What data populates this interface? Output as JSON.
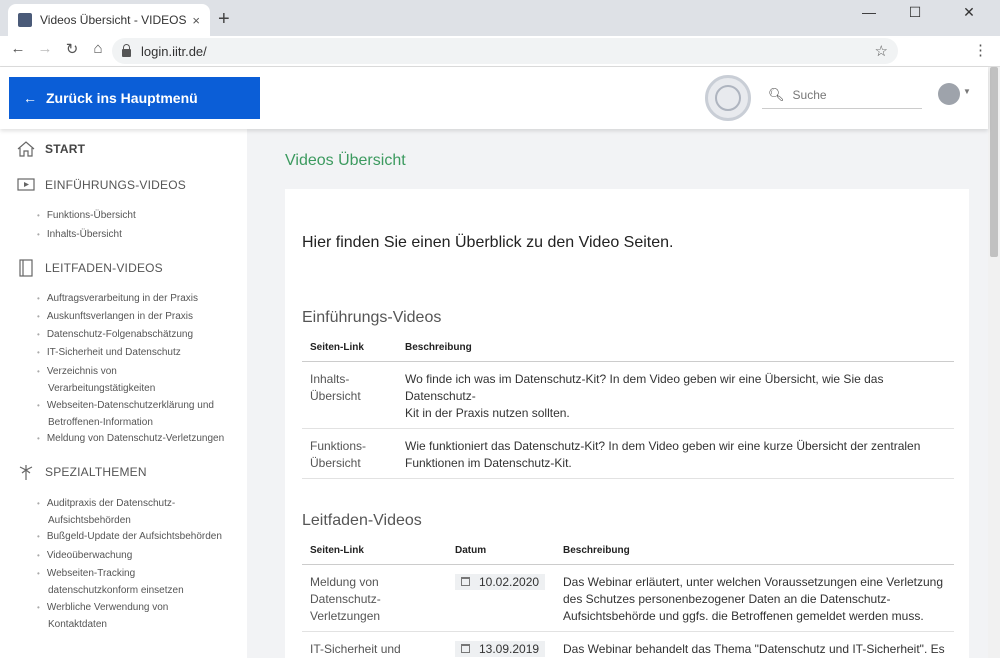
{
  "browser": {
    "tab_title": "Videos Übersicht - VIDEOS - IITR",
    "tab_close": "×",
    "new_tab": "+",
    "url": "login.iitr.de/",
    "minimize": "—",
    "maximize": "☐",
    "close": "✕"
  },
  "header": {
    "back_label": "Zurück ins Hauptmenü",
    "search_placeholder": "Suche"
  },
  "sidebar": {
    "sections": [
      {
        "label": "START",
        "icon": "home-icon",
        "items": []
      },
      {
        "label": "EINFÜHRUNGS-VIDEOS",
        "icon": "video-presentation-icon",
        "items": [
          "Funktions-Übersicht",
          "Inhalts-Übersicht"
        ]
      },
      {
        "label": "LEITFADEN-VIDEOS",
        "icon": "notebook-icon",
        "items": [
          [
            "Auftragsverarbeitung in der Praxis"
          ],
          [
            "Auskunftsverlangen in der Praxis"
          ],
          [
            "Datenschutz-Folgenabschätzung"
          ],
          [
            "IT-Sicherheit und Datenschutz"
          ],
          [
            "Verzeichnis von",
            "Verarbeitungstätigkeiten"
          ],
          [
            "Webseiten-Datenschutzerklärung und",
            "Betroffenen-Information"
          ],
          [
            "Meldung von Datenschutz-Verletzungen"
          ]
        ]
      },
      {
        "label": "SPEZIALTHEMEN",
        "icon": "palm-tree-icon",
        "items": [
          [
            "Auditpraxis der Datenschutz-",
            "Aufsichtsbehörden"
          ],
          [
            "Bußgeld-Update der Aufsichtsbehörden"
          ],
          [
            "Videoüberwachung"
          ],
          [
            "Webseiten-Tracking",
            "datenschutzkonform einsetzen"
          ],
          [
            "Werbliche Verwendung von",
            "Kontaktdaten"
          ]
        ]
      }
    ]
  },
  "main": {
    "title": "Videos Übersicht",
    "intro": "Hier finden Sie einen Überblick zu den Video Seiten.",
    "intro_section": {
      "heading": "Einführungs-Videos",
      "columns": [
        "Seiten-Link",
        "Beschreibung"
      ],
      "rows": [
        {
          "link": [
            "Inhalts-",
            "Übersicht"
          ],
          "desc": [
            "Wo finde ich was im Datenschutz-Kit? In dem Video geben wir eine Übersicht, wie Sie das Datenschutz-",
            "Kit in der Praxis nutzen sollten."
          ]
        },
        {
          "link": [
            "Funktions-",
            "Übersicht"
          ],
          "desc": [
            "Wie funktioniert das Datenschutz-Kit? In dem Video geben wir eine kurze Übersicht der zentralen",
            "Funktionen im Datenschutz-Kit."
          ]
        }
      ]
    },
    "guide_section": {
      "heading": "Leitfaden-Videos",
      "columns": [
        "Seiten-Link",
        "Datum",
        "Beschreibung"
      ],
      "rows": [
        {
          "link": [
            "Meldung von",
            "Datenschutz-",
            "Verletzungen"
          ],
          "date": "10.02.2020",
          "desc": [
            "Das Webinar erläutert, unter welchen Voraussetzungen eine Verletzung",
            "des Schutzes personenbezogener Daten an die Datenschutz-",
            "Aufsichtsbehörde und ggfs. die Betroffenen gemeldet werden muss."
          ]
        },
        {
          "link": [
            "IT-Sicherheit und"
          ],
          "date": "13.09.2019",
          "desc": [
            "Das Webinar behandelt das Thema \"Datenschutz und IT-Sicherheit\". Es"
          ]
        }
      ]
    }
  }
}
